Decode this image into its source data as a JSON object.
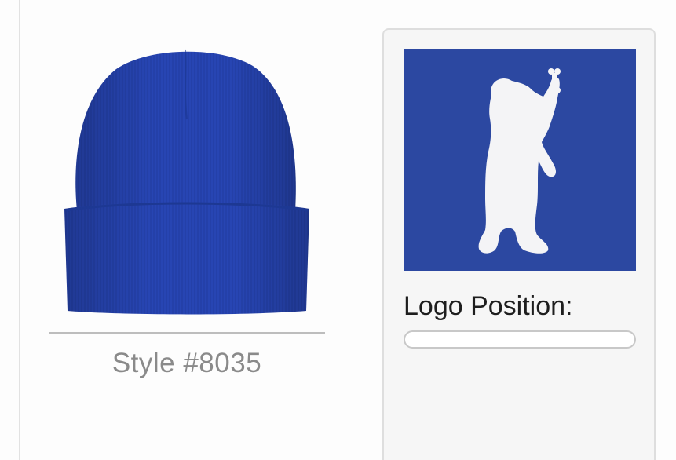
{
  "product": {
    "style_label": "Style #8035",
    "image": "royal-blue-cuffed-beanie"
  },
  "logo_panel": {
    "logo_image": "white-bear-holding-bone",
    "logo_background_color": "#2c48a1",
    "position_label": "Logo Position:",
    "position_value": ""
  },
  "colors": {
    "beanie": "#2745b3",
    "page_background": "#fdfdfd",
    "panel_background": "#f6f6f6"
  }
}
